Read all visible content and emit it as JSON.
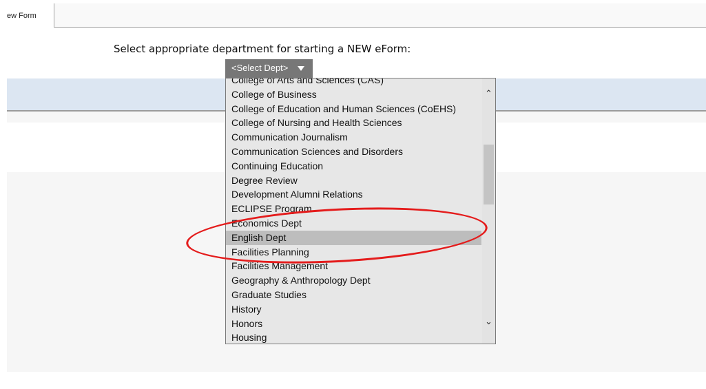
{
  "tabbar": {
    "active_tab": "ew Form"
  },
  "prompt": "Select appropriate department for starting a NEW eForm:",
  "select": {
    "button_label": "<Select Dept>"
  },
  "dropdown": {
    "options": [
      "College of Arts and Sciences (CAS)",
      "College of Business",
      "College of Education and Human Sciences (CoEHS)",
      "College of Nursing and Health Sciences",
      "Communication Journalism",
      "Communication Sciences and Disorders",
      "Continuing Education",
      "Degree Review",
      "Development Alumni Relations",
      "ECLIPSE Program",
      "Economics Dept",
      "English Dept",
      "Facilities Planning",
      "Facilities Management",
      "Geography & Anthropology Dept",
      "Graduate Studies",
      "History",
      "Honors",
      "Housing"
    ],
    "highlighted": "English Dept"
  },
  "colors": {
    "accent_annotation": "#e41c1c",
    "blue_band": "#dce6f2",
    "button_bg": "#777777"
  }
}
